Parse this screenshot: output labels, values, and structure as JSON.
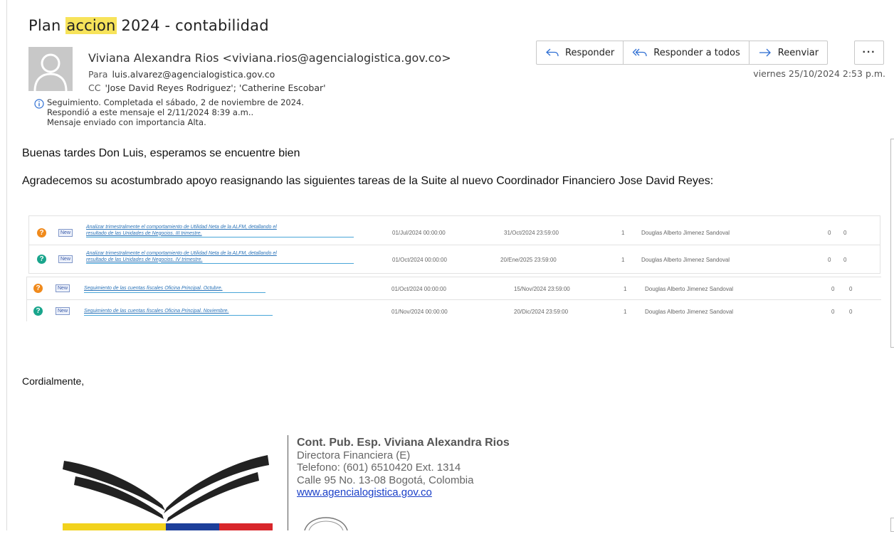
{
  "email": {
    "subject_prefix": "Plan ",
    "subject_highlight": "accion",
    "subject_suffix": " 2024 - contabilidad",
    "sender": "Viviana Alexandra Rios <viviana.rios@agencialogistica.gov.co>",
    "to_label": "Para",
    "to": "luis.alvarez@agencialogistica.gov.co",
    "cc_label": "CC",
    "cc": "'Jose David Reyes Rodriguez'; 'Catherine Escobar'",
    "info_lines": [
      "Seguimiento.  Completada el sábado, 2 de noviembre de 2024.",
      "Respondió a este mensaje el 2/11/2024 8:39 a.m..",
      "Mensaje enviado con importancia Alta."
    ],
    "date": "viernes 25/10/2024 2:53 p.m."
  },
  "toolbar": {
    "reply": "Responder",
    "reply_all": "Responder a todos",
    "forward": "Reenviar",
    "more": "···"
  },
  "body": {
    "greeting": "Buenas tardes Don Luis, esperamos se encuentre bien",
    "paragraph": "Agradecemos su acostumbrado apoyo reasignando las siguientes tareas de la Suite al nuevo Coordinador Financiero Jose David Reyes:",
    "closing": "Cordialmente,"
  },
  "tasks": [
    {
      "status": "?",
      "status_color": "#f08a1c",
      "badge": "New",
      "task_line1": "Analizar trimestralmente el comportamiento de Utilidad Neta de la ALFM, detallando el",
      "task_line2": "resultado de las Unidades de Negocios. III trimestre.",
      "start": "01/Jul/2024 00:00:00",
      "end": "31/Oct/2024 23:59:00",
      "count": "1",
      "owner": "Douglas Alberto Jimenez Sandoval",
      "v1": "0",
      "v2": "0"
    },
    {
      "status": "?",
      "status_color": "#19a58c",
      "badge": "New",
      "task_line1": "Analizar trimestralmente el comportamiento de Utilidad Neta de la ALFM, detallando el",
      "task_line2": "resultado de las Unidades de Negocios. IV trimestre.",
      "start": "01/Oct/2024 00:00:00",
      "end": "20/Ene/2025 23:59:00",
      "count": "1",
      "owner": "Douglas Alberto Jimenez Sandoval",
      "v1": "0",
      "v2": "0"
    },
    {
      "status": "?",
      "status_color": "#f08a1c",
      "badge": "New",
      "task_line1": "Seguimiento de las cuentas fiscales Oficina Principal. Octubre.",
      "start": "01/Oct/2024 00:00:00",
      "end": "15/Nov/2024 23:59:00",
      "count": "1",
      "owner": "Douglas Alberto Jimenez Sandoval",
      "v1": "0",
      "v2": "0"
    },
    {
      "status": "?",
      "status_color": "#19a58c",
      "badge": "New",
      "task_line1": "Seguimiento de las cuentas fiscales Oficina Principal. Noviembre.",
      "start": "01/Nov/2024 00:00:00",
      "end": "20/Dic/2024 23:59:00",
      "count": "1",
      "owner": "Douglas Alberto Jimenez Sandoval",
      "v1": "0",
      "v2": "0"
    }
  ],
  "signature": {
    "name": "Cont. Pub. Esp. Viviana Alexandra Rios",
    "title": "Directora Financiera (E)",
    "phone": "Telefono: (601) 6510420 Ext. 1314",
    "address": "Calle 95 No. 13-08 Bogotá, Colombia",
    "website": "www.agencialogistica.gov.co"
  },
  "colors": {
    "highlight": "#f7e35a",
    "accent_blue": "#2f6fd3",
    "status_orange": "#f08a1c",
    "status_teal": "#19a58c",
    "link": "#1a3fc8"
  },
  "icons": [
    "avatar-icon",
    "reply-icon",
    "reply-all-icon",
    "forward-icon",
    "more-icon",
    "info-icon",
    "question-icon"
  ]
}
